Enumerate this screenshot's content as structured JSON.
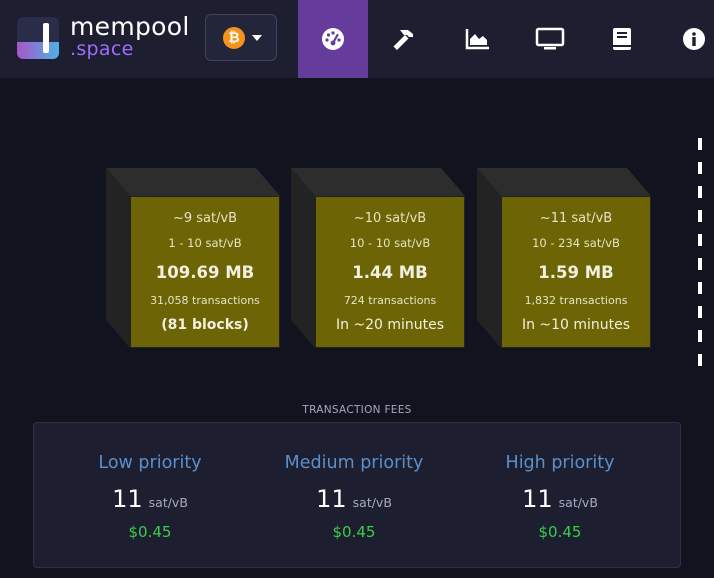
{
  "header": {
    "brand_main": "mempool",
    "brand_sub": ".space",
    "network_icon_glyph": "₿",
    "nav": [
      {
        "icon": "dashboard-gauge-icon",
        "active": true
      },
      {
        "icon": "hammer-icon",
        "active": false
      },
      {
        "icon": "area-chart-icon",
        "active": false
      },
      {
        "icon": "monitor-icon",
        "active": false
      },
      {
        "icon": "book-icon",
        "active": false
      },
      {
        "icon": "info-icon",
        "active": false
      }
    ]
  },
  "mempool_blocks": [
    {
      "median_fee": "~9 sat/vB",
      "fee_range": "1 - 10 sat/vB",
      "size": "109.69 MB",
      "tx_count": "31,058 transactions",
      "eta": "(81 blocks)"
    },
    {
      "median_fee": "~10 sat/vB",
      "fee_range": "10 - 10 sat/vB",
      "size": "1.44 MB",
      "tx_count": "724 transactions",
      "eta": "In ~20 minutes"
    },
    {
      "median_fee": "~11 sat/vB",
      "fee_range": "10 - 234 sat/vB",
      "size": "1.59 MB",
      "tx_count": "1,832 transactions",
      "eta": "In ~10 minutes"
    }
  ],
  "fees": {
    "title": "TRANSACTION FEES",
    "unit": "sat/vB",
    "columns": [
      {
        "label": "Low priority",
        "rate": "11",
        "usd": "$0.45"
      },
      {
        "label": "Medium priority",
        "rate": "11",
        "usd": "$0.45"
      },
      {
        "label": "High priority",
        "rate": "11",
        "usd": "$0.45"
      }
    ]
  },
  "colors": {
    "header_bg": "#1d1f31",
    "active_nav": "#653b9c",
    "block_face": "#6d6405",
    "priority_label": "#5b8fc9",
    "usd_value": "#3bcc49"
  }
}
